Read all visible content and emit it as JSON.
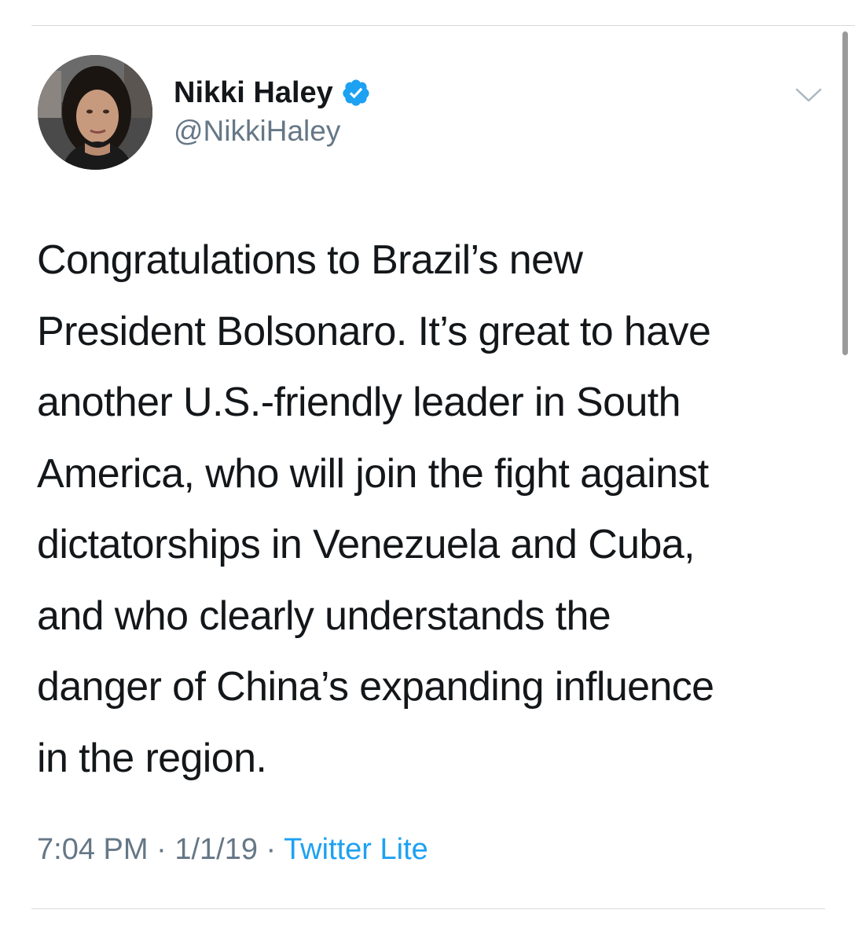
{
  "tweet": {
    "author": {
      "display_name": "Nikki Haley",
      "handle": "@NikkiHaley",
      "verified": true,
      "verified_icon": "verified-badge-icon"
    },
    "menu_icon": "chevron-down-icon",
    "text_lines": [
      "Congratulations to Brazil’s new",
      "President Bolsonaro.  It’s great to have",
      "another U.S.-friendly leader in South",
      "America, who will join the fight against",
      "dictatorships in Venezuela and Cuba,",
      "and who clearly understands the",
      "danger of China’s expanding influence",
      "in the region."
    ],
    "time": "7:04 PM",
    "date": "1/1/19",
    "separator": "·",
    "source": "Twitter Lite"
  },
  "colors": {
    "primary_text": "#14171a",
    "secondary_text": "#657786",
    "link": "#1da1f2",
    "verified": "#1da1f2",
    "divider": "#d6d9dc"
  }
}
